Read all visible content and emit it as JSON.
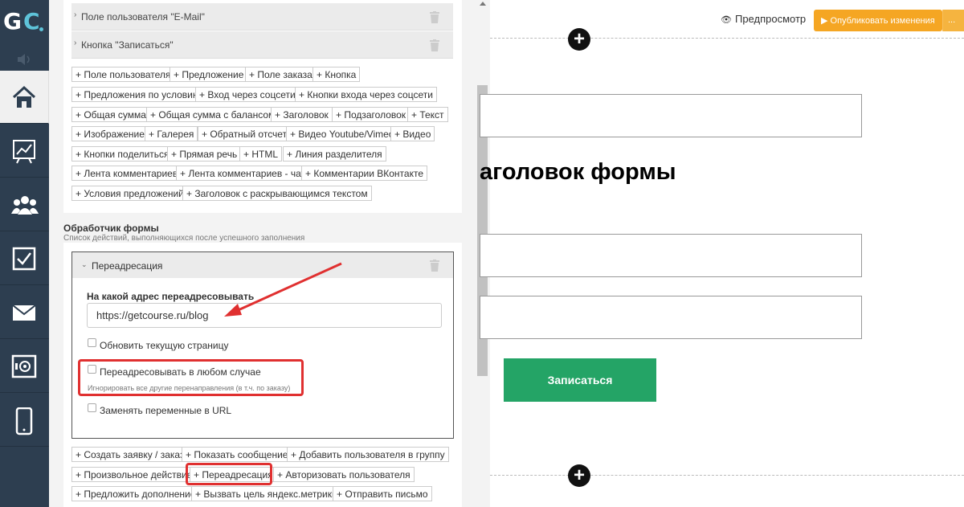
{
  "logo": {
    "text1": "G",
    "text2": "C"
  },
  "nav": [
    {
      "icon": "home-icon",
      "active": true
    },
    {
      "icon": "chart-icon",
      "active": false
    },
    {
      "icon": "users-icon",
      "active": false
    },
    {
      "icon": "checkbox-icon",
      "active": false
    },
    {
      "icon": "mail-icon",
      "active": false
    },
    {
      "icon": "safe-icon",
      "active": false
    },
    {
      "icon": "phone-icon",
      "active": false
    }
  ],
  "fields": [
    {
      "label": "Поле пользователя \"E-Mail\""
    },
    {
      "label": "Кнопка \"Записаться\""
    }
  ],
  "add_blocks": [
    [
      "+ Поле пользователя",
      "+ Предложение",
      "+ Поле заказа",
      "+ Кнопка"
    ],
    [
      "+ Предложения по условию",
      "+ Вход через соцсети",
      "+ Кнопки входа через соцсети"
    ],
    [
      "+ Общая сумма",
      "+ Общая сумма с балансом",
      "+ Заголовок",
      "+ Подзаголовок",
      "+ Текст"
    ],
    [
      "+ Изображение",
      "+ Галерея",
      "+ Обратный отсчет",
      "+ Видео Youtube/Vimeo",
      "+ Видео"
    ],
    [
      "+ Кнопки поделиться",
      "+ Прямая речь",
      "+ HTML",
      "+ Линия разделителя"
    ],
    [
      "+ Лента комментариев",
      "+ Лента комментариев - чат",
      "+ Комментарии ВКонтакте"
    ],
    [
      "+ Условия предложений",
      "+ Заголовок с раскрывающимся текстом"
    ]
  ],
  "handler": {
    "title": "Обработчик формы",
    "subtitle": "Список действий, выполняющихся после успешного заполнения"
  },
  "redirect": {
    "title": "Переадресация",
    "address_label": "На какой адрес переадресовывать",
    "address_value": "https://getcourse.ru/blog",
    "cb_refresh": "Обновить текущую страницу",
    "cb_any": "Переадресовывать в любом случае",
    "cb_any_hint": "Игнорировать все другие перенаправления (в т.ч. по заказу)",
    "cb_vars": "Заменять переменные в URL"
  },
  "actions": [
    [
      "+ Создать заявку / заказ",
      "+ Показать сообщение",
      "+ Добавить пользователя в группу"
    ],
    [
      "+ Произвольное действие",
      "+ Переадресация",
      "+ Авторизовать пользователя"
    ],
    [
      "+ Предложить дополнение",
      "+ Вызвать цель яндекс.метрики",
      "+ Отправить письмо"
    ]
  ],
  "toolbar": {
    "preview": "Предпросмотр",
    "publish": "▶ Опубликовать изменения",
    "more": "..."
  },
  "canvas": {
    "heading": "аголовок формы",
    "submit": "Записаться",
    "plus": "+"
  },
  "colors": {
    "nav_bg": "#2d3e50",
    "logo_accent": "#5ec3d9",
    "publish": "#f5a623",
    "submit": "#24a466",
    "annotation": "#e03030"
  }
}
